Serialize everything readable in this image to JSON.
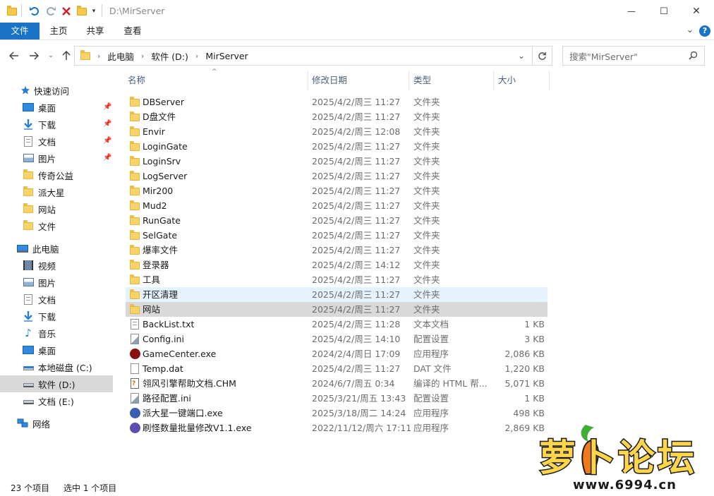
{
  "window": {
    "title": "D:\\MirServer",
    "minimize_glyph": "—",
    "maximize_glyph": "☐",
    "close_glyph": "✕"
  },
  "ribbon": {
    "tabs": [
      "文件",
      "主页",
      "共享",
      "查看"
    ],
    "help_glyph": "?",
    "expand_glyph": "⌄"
  },
  "address": {
    "crumbs": [
      "此电脑",
      "软件 (D:)",
      "MirServer"
    ],
    "search_placeholder": "搜索\"MirServer\""
  },
  "sidebar": {
    "quick_access": "快速访问",
    "quick_items": [
      "桌面",
      "下载",
      "文档",
      "图片",
      "传奇公益",
      "派大星",
      "网站",
      "文件"
    ],
    "this_pc": "此电脑",
    "pc_items": [
      "视频",
      "图片",
      "文档",
      "下载",
      "音乐",
      "桌面",
      "本地磁盘 (C:)",
      "软件 (D:)",
      "文档 (E:)"
    ],
    "network": "网络"
  },
  "columns": {
    "name": "名称",
    "date": "修改日期",
    "type": "类型",
    "size": "大小"
  },
  "files": [
    {
      "name": "DBServer",
      "date": "2025/4/2/周三 11:27",
      "type": "文件夹",
      "size": "",
      "icon": "folder-icon"
    },
    {
      "name": "D盘文件",
      "date": "2025/4/2/周三 11:27",
      "type": "文件夹",
      "size": "",
      "icon": "folder-icon"
    },
    {
      "name": "Envir",
      "date": "2025/4/2/周三 12:08",
      "type": "文件夹",
      "size": "",
      "icon": "folder-icon"
    },
    {
      "name": "LoginGate",
      "date": "2025/4/2/周三 11:27",
      "type": "文件夹",
      "size": "",
      "icon": "folder-icon"
    },
    {
      "name": "LoginSrv",
      "date": "2025/4/2/周三 11:27",
      "type": "文件夹",
      "size": "",
      "icon": "folder-icon"
    },
    {
      "name": "LogServer",
      "date": "2025/4/2/周三 11:27",
      "type": "文件夹",
      "size": "",
      "icon": "folder-icon"
    },
    {
      "name": "Mir200",
      "date": "2025/4/2/周三 11:27",
      "type": "文件夹",
      "size": "",
      "icon": "folder-icon"
    },
    {
      "name": "Mud2",
      "date": "2025/4/2/周三 11:27",
      "type": "文件夹",
      "size": "",
      "icon": "folder-icon"
    },
    {
      "name": "RunGate",
      "date": "2025/4/2/周三 11:27",
      "type": "文件夹",
      "size": "",
      "icon": "folder-icon"
    },
    {
      "name": "SelGate",
      "date": "2025/4/2/周三 11:27",
      "type": "文件夹",
      "size": "",
      "icon": "folder-icon"
    },
    {
      "name": "爆率文件",
      "date": "2025/4/2/周三 11:27",
      "type": "文件夹",
      "size": "",
      "icon": "folder-icon"
    },
    {
      "name": "登录器",
      "date": "2025/4/2/周三 14:12",
      "type": "文件夹",
      "size": "",
      "icon": "folder-icon"
    },
    {
      "name": "工具",
      "date": "2025/4/2/周三 11:27",
      "type": "文件夹",
      "size": "",
      "icon": "folder-icon"
    },
    {
      "name": "开区清理",
      "date": "2025/4/2/周三 11:27",
      "type": "文件夹",
      "size": "",
      "icon": "folder-icon"
    },
    {
      "name": "网站",
      "date": "2025/4/2/周三 11:27",
      "type": "文件夹",
      "size": "",
      "icon": "folder-icon"
    },
    {
      "name": "BackList.txt",
      "date": "2025/4/2/周三 11:28",
      "type": "文本文档",
      "size": "1 KB",
      "icon": "text-file-icon"
    },
    {
      "name": "Config.ini",
      "date": "2025/4/2/周三 14:10",
      "type": "配置设置",
      "size": "3 KB",
      "icon": "config-file-icon"
    },
    {
      "name": "GameCenter.exe",
      "date": "2024/2/4/周日 17:09",
      "type": "应用程序",
      "size": "2,086 KB",
      "icon": "app-icon"
    },
    {
      "name": "Temp.dat",
      "date": "2025/4/2/周三 11:27",
      "type": "DAT 文件",
      "size": "1,220 KB",
      "icon": "file-icon"
    },
    {
      "name": "翎风引擎帮助文档.CHM",
      "date": "2024/6/7/周五 0:34",
      "type": "编译的 HTML 帮...",
      "size": "5,071 KB",
      "icon": "help-file-icon"
    },
    {
      "name": "路径配置.ini",
      "date": "2025/3/21/周五 13:43",
      "type": "配置设置",
      "size": "1 KB",
      "icon": "config-file-icon"
    },
    {
      "name": "派大星一键端口.exe",
      "date": "2025/3/18/周二 14:24",
      "type": "应用程序",
      "size": "498 KB",
      "icon": "app-icon"
    },
    {
      "name": "刷怪数量批量修改V1.1.exe",
      "date": "2022/11/12/周六 17:11",
      "type": "应用程序",
      "size": "2,869 KB",
      "icon": "app-icon"
    }
  ],
  "status": {
    "count": "23 个项目",
    "selected": "选中 1 个项目"
  },
  "watermark": {
    "text": "萝卜论坛",
    "url": "www.6994.cn"
  }
}
